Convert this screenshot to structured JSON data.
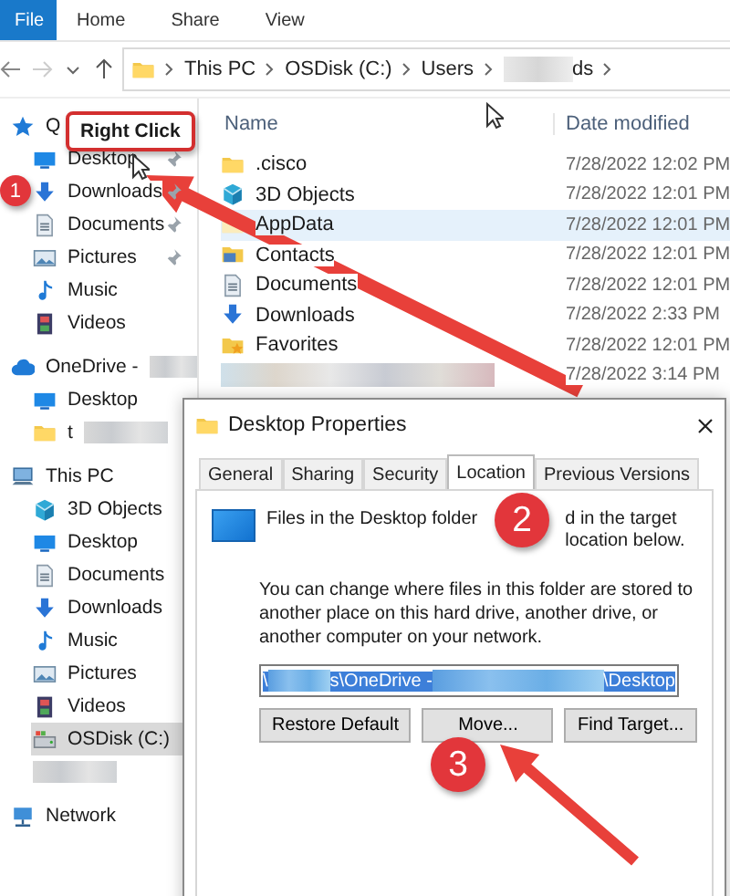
{
  "ribbon": {
    "file_button": "File",
    "tabs": [
      {
        "label": "Home",
        "selected": false
      },
      {
        "label": "Share",
        "selected": false
      },
      {
        "label": "View",
        "selected": false
      }
    ]
  },
  "address_bar": {
    "crumbs": [
      {
        "kind": "text",
        "label": "This PC"
      },
      {
        "kind": "text",
        "label": "OSDisk (C:)"
      },
      {
        "kind": "text",
        "label": "Users"
      },
      {
        "kind": "redacted",
        "label": "ds"
      }
    ]
  },
  "sidebar": {
    "sections": [
      {
        "items": [
          {
            "kind": "star",
            "label": "Q",
            "redacted": false,
            "pinned": false,
            "selected": false
          },
          {
            "kind": "desktop",
            "label": "Desktop",
            "redacted": false,
            "pinned": true,
            "selected": false
          },
          {
            "kind": "download",
            "label": "Downloads",
            "redacted": false,
            "pinned": true,
            "selected": false
          },
          {
            "kind": "document",
            "label": "Documents",
            "redacted": false,
            "pinned": true,
            "selected": false
          },
          {
            "kind": "picture",
            "label": "Pictures",
            "redacted": false,
            "pinned": true,
            "selected": false
          },
          {
            "kind": "music",
            "label": "Music",
            "redacted": false,
            "pinned": false,
            "selected": false
          },
          {
            "kind": "video",
            "label": "Videos",
            "redacted": false,
            "pinned": false,
            "selected": false
          }
        ]
      },
      {
        "items": [
          {
            "kind": "cloud",
            "label": "OneDrive -",
            "redacted": true,
            "pinned": false,
            "selected": false
          },
          {
            "kind": "desktop",
            "label": "Desktop",
            "redacted": false,
            "pinned": false,
            "selected": false
          },
          {
            "kind": "folder",
            "label": "t",
            "redacted": true,
            "pinned": false,
            "selected": false
          }
        ]
      },
      {
        "items": [
          {
            "kind": "pc",
            "label": "This PC",
            "redacted": false,
            "pinned": false,
            "selected": false
          },
          {
            "kind": "cube",
            "label": "3D Objects",
            "redacted": false,
            "pinned": false,
            "selected": false
          },
          {
            "kind": "desktop",
            "label": "Desktop",
            "redacted": false,
            "pinned": false,
            "selected": false
          },
          {
            "kind": "document",
            "label": "Documents",
            "redacted": false,
            "pinned": false,
            "selected": false
          },
          {
            "kind": "download",
            "label": "Downloads",
            "redacted": false,
            "pinned": false,
            "selected": false
          },
          {
            "kind": "music",
            "label": "Music",
            "redacted": false,
            "pinned": false,
            "selected": false
          },
          {
            "kind": "picture",
            "label": "Pictures",
            "redacted": false,
            "pinned": false,
            "selected": false
          },
          {
            "kind": "video",
            "label": "Videos",
            "redacted": false,
            "pinned": false,
            "selected": false
          },
          {
            "kind": "disk",
            "label": "OSDisk (C:)",
            "redacted": false,
            "pinned": false,
            "selected": true
          },
          {
            "kind": "blank",
            "redacted": true,
            "pinned": false,
            "selected": false
          }
        ]
      },
      {
        "items": [
          {
            "kind": "network",
            "label": "Network",
            "redacted": false,
            "pinned": false,
            "selected": false
          }
        ]
      }
    ]
  },
  "file_list": {
    "columns": [
      "Name",
      "Date modified"
    ],
    "rows": [
      {
        "kind": "folder",
        "name": ".cisco",
        "date": "7/28/2022 12:02 PM",
        "selected": false
      },
      {
        "kind": "cube",
        "name": "3D Objects",
        "date": "7/28/2022 12:01 PM",
        "selected": false
      },
      {
        "kind": "hidden",
        "name": "AppData",
        "date": "7/28/2022 12:01 PM",
        "selected": true
      },
      {
        "kind": "contacts",
        "name": "Contacts",
        "date": "7/28/2022 12:01 PM",
        "selected": false
      },
      {
        "kind": "document",
        "name": "Documents",
        "date": "7/28/2022 12:01 PM",
        "selected": false
      },
      {
        "kind": "download",
        "name": "Downloads",
        "date": "7/28/2022 2:33 PM",
        "selected": false
      },
      {
        "kind": "favorites",
        "name": "Favorites",
        "date": "7/28/2022 12:01 PM",
        "selected": false
      },
      {
        "kind": "redacted",
        "date": "7/28/2022 3:14 PM",
        "selected": false
      }
    ]
  },
  "dialog": {
    "title": "Desktop Properties",
    "tabs": [
      {
        "label": "General",
        "selected": false
      },
      {
        "label": "Sharing",
        "selected": false
      },
      {
        "label": "Security",
        "selected": false
      },
      {
        "label": "Location",
        "selected": true
      },
      {
        "label": "Previous Versions",
        "selected": false
      }
    ],
    "description_start": "Files in the Desktop folder",
    "description_end": "d in the target location below.",
    "info": "You can change where files in this folder are stored to another place on this hard drive, another drive, or another computer on your network.",
    "path_selected": true,
    "path": [
      {
        "kind": "text",
        "text": "\\"
      },
      {
        "kind": "redacted"
      },
      {
        "kind": "text",
        "text": "s\\OneDrive -"
      },
      {
        "kind": "redacted"
      },
      {
        "kind": "text",
        "text": "\\Desktop"
      }
    ],
    "buttons": [
      "Restore Default",
      "Move...",
      "Find Target..."
    ]
  },
  "annotations": {
    "callout": "Right Click",
    "steps": [
      "1",
      "2",
      "3"
    ]
  }
}
